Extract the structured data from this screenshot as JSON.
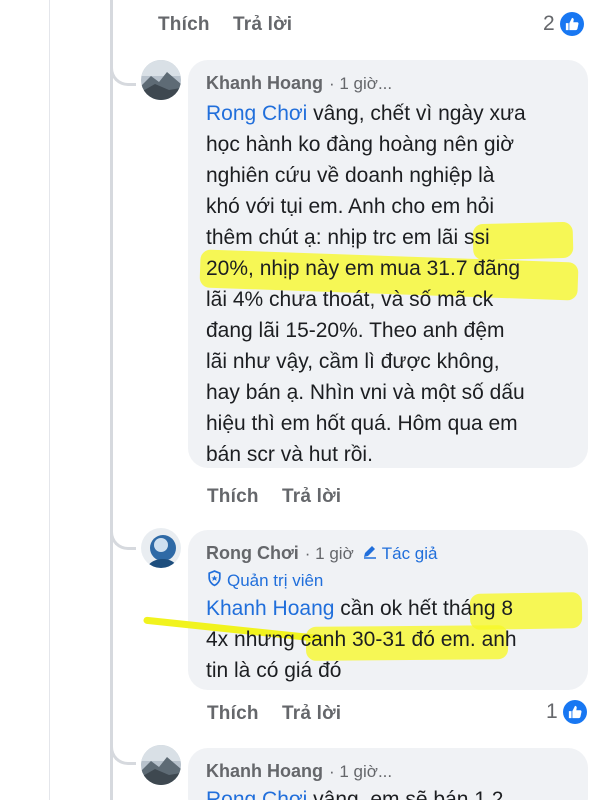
{
  "top_actions": {
    "like": "Thích",
    "reply": "Trả lời",
    "reaction_count": "2"
  },
  "comment1": {
    "author": "Khanh Hoang",
    "meta": "· 1 giờ...",
    "mention": "Rong Chơi",
    "lines": [
      " vâng, chết vì ngày xưa",
      "học hành ko đàng hoàng nên giờ",
      "nghiên cứu về doanh nghiệp là",
      "khó với tụi em. Anh cho em hỏi",
      "thêm chút ạ: nhịp trc em lãi ssi",
      "20%, nhịp này em mua 31.7 đãng",
      "lãi 4% chưa thoát, và số mã ck",
      "đang lãi 15-20%. Theo anh đệm",
      "lãi như vậy, cầm lì được không,",
      "hay bán ạ. Nhìn vni và một số dấu",
      "hiệu thì em hốt quá. Hôm qua em",
      "bán scr và hut rồi."
    ],
    "like": "Thích",
    "reply": "Trả lời"
  },
  "comment2": {
    "author": "Rong Chơi",
    "meta": "· 1 giờ",
    "author_tag": "Tác giả",
    "role": "Quản trị viên",
    "mention": "Khanh Hoang",
    "lines": [
      "  cần ok hết tháng 8",
      "4x nhưng canh 30-31 đó em. anh",
      "tin là có giá đó"
    ],
    "like": "Thích",
    "reply": "Trả lời",
    "reaction_count": "1"
  },
  "comment3": {
    "author": "Khanh Hoang",
    "meta": "· 1 giờ...",
    "mention": "Rong Chơi",
    "partial_line": " vâng, em sẽ bán 1.2"
  },
  "colors": {
    "mention": "#216fdb",
    "highlight": "#f7f828",
    "like_blue": "#1877f2",
    "bubble_bg": "#f0f2f5"
  }
}
